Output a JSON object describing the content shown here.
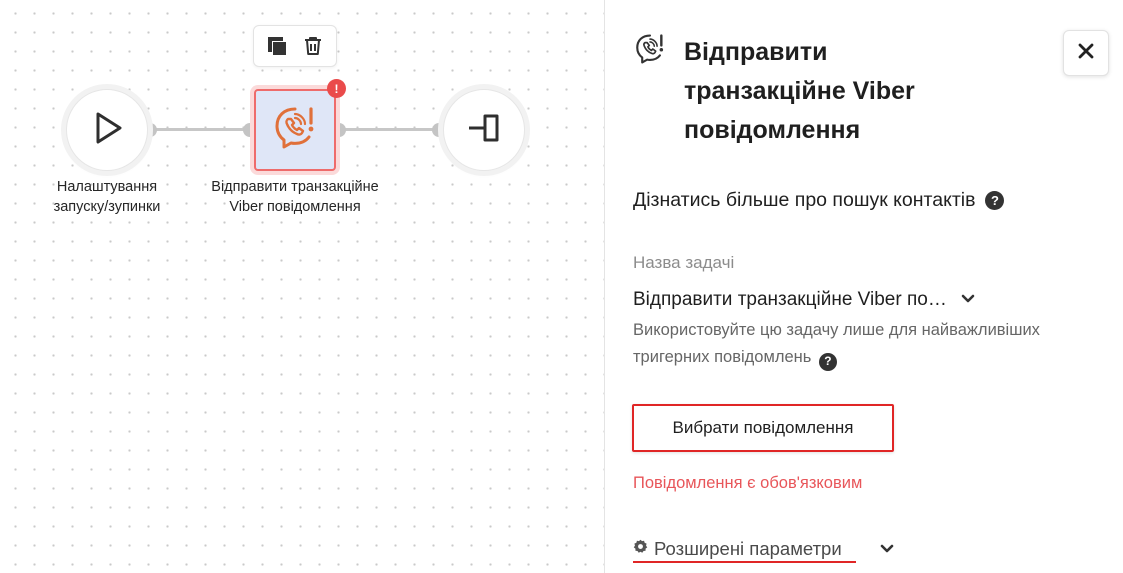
{
  "canvas": {
    "toolbar": {
      "copy_icon": "copy-icon",
      "delete_icon": "trash-icon"
    },
    "nodes": [
      {
        "id": "start",
        "icon": "play-icon",
        "label_line1": "Налаштування",
        "label_line2": "запуску/зупинки"
      },
      {
        "id": "viber",
        "icon": "viber-phone-alert-icon",
        "label_line1": "Відправити транзакційне",
        "label_line2": "Viber повідомлення",
        "badge": "!",
        "error_color": "#ea4b4b"
      },
      {
        "id": "end",
        "icon": "exit-icon"
      }
    ]
  },
  "panel": {
    "icon": "viber-phone-alert-icon",
    "title_line1": "Відправити",
    "title_line2": "транзакційне Viber",
    "title_line3": "повідомлення",
    "close_icon": "close-icon",
    "learn_more": "Дізнатись більше про пошук контактів",
    "task_name_label": "Назва задачі",
    "task_name_value": "Відправити транзакційне Viber по…",
    "hint": "Використовуйте цю задачу лише для найважливіших тригерних повідомлень",
    "choose_button": "Вибрати повідомлення",
    "error_message": "Повідомлення є обов'язковим",
    "advanced_label": "Розширені параметри",
    "accent_color": "#e02626",
    "error_text_color": "#e8565a"
  }
}
